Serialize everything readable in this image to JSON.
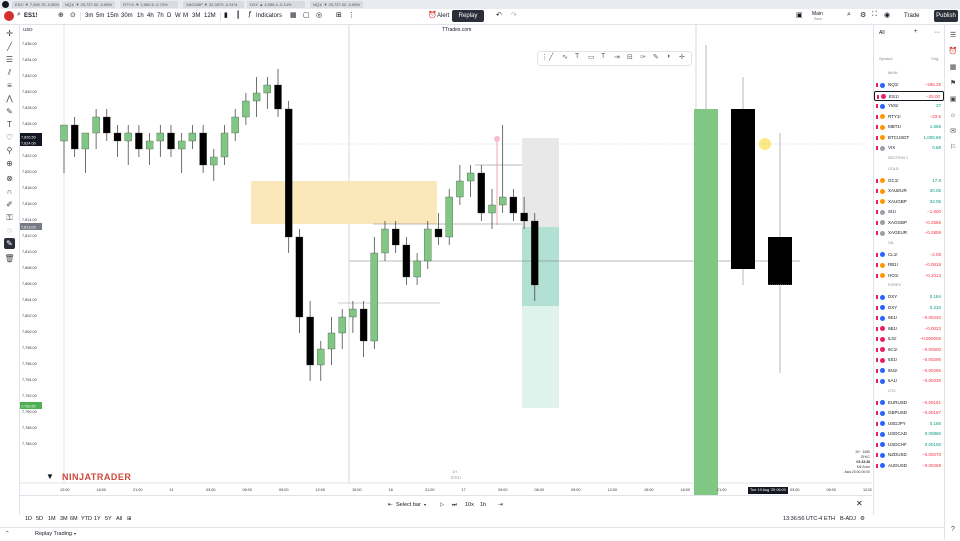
{
  "tabs": [
    {
      "label": "ES1! ▼ 7,590.75 -0.85%"
    },
    {
      "label": "NQ1! ▼ 25,727.00 -0.86%"
    },
    {
      "label": "RTY1! ▼ 2,560.6 -0.74%"
    },
    {
      "label": "XAGGBP ▼ 32.0579 -0.51%"
    },
    {
      "label": "DXY ▲ 4,556.4 -0.14%"
    },
    {
      "label": "NQ1! ▼ 25,727.00 -0.86%"
    }
  ],
  "toolbar": {
    "symbol": "ES1!",
    "intervals": [
      "3m",
      "5m",
      "15m",
      "30m",
      "1h",
      "4h",
      "7h",
      "D",
      "W",
      "M",
      "3M",
      "12M"
    ],
    "indicators_label": "Indicators",
    "alert_label": "Alert",
    "replay_label": "Replay",
    "layout_name": "Main",
    "layout_sub": "Save",
    "trade_label": "Trade",
    "publish_label": "Publish"
  },
  "chart": {
    "currency": "USD",
    "watermark": "TTrades.com",
    "brand": "NINJATRADER",
    "center_label_1": "1H",
    "center_label_2": "ES1!",
    "price_ticks": [
      "7,836.00",
      "7,834.00",
      "7,832.00",
      "7,830.00",
      "7,828.00",
      "7,826.00",
      "7,824.00",
      "7,822.00",
      "7,820.00",
      "7,818.00",
      "7,816.00",
      "7,814.00",
      "7,812.00",
      "7,810.00",
      "7,808.00",
      "7,806.00",
      "7,804.00",
      "7,802.00",
      "7,800.00",
      "7,798.00",
      "7,796.00",
      "7,794.00",
      "7,792.00",
      "7,790.00",
      "7,788.00",
      "7,786.00"
    ],
    "price_tags": [
      {
        "label": "7,826.50",
        "color": "#131722"
      },
      {
        "label": "7,824.00",
        "color": "#131722"
      },
      {
        "label": "7,813.00",
        "color": "#787b86"
      },
      {
        "label": "7,790.50",
        "color": "#4caf50"
      }
    ],
    "time_ticks": [
      "12:00",
      "18:00",
      "21:00",
      "11",
      "03:00",
      "06:00",
      "09:00",
      "12:00",
      "15:00",
      "18",
      "21:00",
      "17",
      "03:00",
      "06:00",
      "09:00",
      "12:00",
      "15:00",
      "18:00",
      "21:00",
      "18",
      "03:00",
      "06:00",
      "12:00"
    ],
    "cursor_time": "Tue 19 Aug '25 06:00",
    "info_box": [
      "1H · 1080",
      "OHLC",
      "03:43:38",
      "Kill Zone",
      "Asia 20:00-00:00"
    ]
  },
  "watchlist": {
    "header": "All",
    "col_symbol": "Symbol",
    "col_change": "Chg",
    "rows": [
      {
        "type": "section",
        "label": "MAIN"
      },
      {
        "type": "item",
        "symbol": "NQ1!",
        "change": "−265.25",
        "color": "#f23645",
        "dot": "#2962ff"
      },
      {
        "type": "item",
        "symbol": "ES1!",
        "change": "−25.00",
        "color": "#f23645",
        "dot": "#e91e63",
        "selected": true
      },
      {
        "type": "item",
        "symbol": "YM1!",
        "change": "37",
        "color": "#089981",
        "dot": "#2962ff"
      },
      {
        "type": "item",
        "symbol": "RTY1!",
        "change": "−23.6",
        "color": "#f23645",
        "dot": "#ff9800"
      },
      {
        "type": "item",
        "symbol": "MBT1!",
        "change": "1,665",
        "color": "#089981",
        "dot": "#ff9800"
      },
      {
        "type": "item",
        "symbol": "BTCUSDT",
        "change": "1,000.86",
        "color": "#089981",
        "dot": "#ff9800"
      },
      {
        "type": "item",
        "symbol": "VIX",
        "change": "0.68",
        "color": "#089981",
        "dot": "#9aa0a6"
      },
      {
        "type": "section",
        "label": "SECTION 1"
      },
      {
        "type": "section",
        "label": "GOLD"
      },
      {
        "type": "item",
        "symbol": "GC1!",
        "change": "17.8",
        "color": "#089981",
        "dot": "#ff9800"
      },
      {
        "type": "item",
        "symbol": "XAUEUR",
        "change": "20.05",
        "color": "#089981",
        "dot": "#ff9800"
      },
      {
        "type": "item",
        "symbol": "XAUGBP",
        "change": "32.05",
        "color": "#089981",
        "dot": "#ff9800"
      },
      {
        "type": "item",
        "symbol": "SI1!",
        "change": "−1.000",
        "color": "#f23645",
        "dot": "#9aa0a6"
      },
      {
        "type": "item",
        "symbol": "XAGGBP",
        "change": "−0.2565",
        "color": "#f23645",
        "dot": "#9aa0a6"
      },
      {
        "type": "item",
        "symbol": "XAGEUR",
        "change": "−0.2858",
        "color": "#f23645",
        "dot": "#9aa0a6"
      },
      {
        "type": "section",
        "label": "OIL"
      },
      {
        "type": "item",
        "symbol": "CL1!",
        "change": "−2.08",
        "color": "#f23645",
        "dot": "#2962ff"
      },
      {
        "type": "item",
        "symbol": "RB1!",
        "change": "−0.0818",
        "color": "#f23645",
        "dot": "#ff9800"
      },
      {
        "type": "item",
        "symbol": "HO1!",
        "change": "−0.2013",
        "color": "#f23645",
        "dot": "#ff9800"
      },
      {
        "type": "section",
        "label": "FOREX"
      },
      {
        "type": "item",
        "symbol": "DXY",
        "change": "0.184",
        "color": "#089981",
        "dot": "#2962ff"
      },
      {
        "type": "item",
        "symbol": "DXY",
        "change": "0.210",
        "color": "#089981",
        "dot": "#2962ff"
      },
      {
        "type": "item",
        "symbol": "6E1!",
        "change": "−0.00240",
        "color": "#f23645",
        "dot": "#2962ff"
      },
      {
        "type": "item",
        "symbol": "6B1!",
        "change": "−0.0023",
        "color": "#f23645",
        "dot": "#e91e63"
      },
      {
        "type": "item",
        "symbol": "6J1!",
        "change": "−0.000006",
        "color": "#f23645",
        "dot": "#e91e63"
      },
      {
        "type": "item",
        "symbol": "6C1!",
        "change": "−0.00500",
        "color": "#f23645",
        "dot": "#e91e63"
      },
      {
        "type": "item",
        "symbol": "6S1!",
        "change": "−0.00295",
        "color": "#f23645",
        "dot": "#e91e63"
      },
      {
        "type": "item",
        "symbol": "6N1!",
        "change": "−0.00295",
        "color": "#f23645",
        "dot": "#2962ff"
      },
      {
        "type": "item",
        "symbol": "6A1!",
        "change": "−0.00335",
        "color": "#f23645",
        "dot": "#2962ff"
      },
      {
        "type": "section",
        "label": "OTC"
      },
      {
        "type": "item",
        "symbol": "EURUSD",
        "change": "−0.00181",
        "color": "#f23645",
        "dot": "#2962ff"
      },
      {
        "type": "item",
        "symbol": "GBPUSD",
        "change": "−0.00187",
        "color": "#f23645",
        "dot": "#2962ff"
      },
      {
        "type": "item",
        "symbol": "USDJPY",
        "change": "0.166",
        "color": "#089981",
        "dot": "#2962ff"
      },
      {
        "type": "item",
        "symbol": "USDCAD",
        "change": "0.00860",
        "color": "#089981",
        "dot": "#2962ff"
      },
      {
        "type": "item",
        "symbol": "USDCHF",
        "change": "0.00150",
        "color": "#089981",
        "dot": "#2962ff"
      },
      {
        "type": "item",
        "symbol": "NZDUSD",
        "change": "−0.00270",
        "color": "#f23645",
        "dot": "#2962ff"
      },
      {
        "type": "item",
        "symbol": "AUDUSD",
        "change": "−0.00258",
        "color": "#f23645",
        "dot": "#2962ff"
      }
    ]
  },
  "replay_bar": {
    "select_bar": "Select bar",
    "speed": "10x",
    "interval": "1h"
  },
  "range_bar": {
    "ranges": [
      "1D",
      "5D",
      "1M",
      "3M",
      "6M",
      "YTD",
      "1Y",
      "5Y",
      "All"
    ],
    "time": "13:36:56 UTC-4",
    "session": "ETH",
    "adj": "B-ADJ"
  },
  "status": {
    "label": "Replay Trading"
  },
  "colors": {
    "bull": "#81c784",
    "bear": "#000000",
    "fvg": "#f9e6b3",
    "target": "#b2e0d2",
    "stop": "#e8e8e8"
  },
  "candles": [
    {
      "o": 7824,
      "h": 7826,
      "l": 7820,
      "c": 7826
    },
    {
      "o": 7826,
      "h": 7827,
      "l": 7822,
      "c": 7823
    },
    {
      "o": 7823,
      "h": 7825,
      "l": 7820,
      "c": 7825
    },
    {
      "o": 7825,
      "h": 7828,
      "l": 7823,
      "c": 7827
    },
    {
      "o": 7827,
      "h": 7828,
      "l": 7824,
      "c": 7825
    },
    {
      "o": 7825,
      "h": 7826,
      "l": 7822,
      "c": 7824
    },
    {
      "o": 7824,
      "h": 7826,
      "l": 7821,
      "c": 7825
    },
    {
      "o": 7825,
      "h": 7826,
      "l": 7822,
      "c": 7823
    },
    {
      "o": 7823,
      "h": 7825,
      "l": 7821,
      "c": 7824
    },
    {
      "o": 7824,
      "h": 7826,
      "l": 7822,
      "c": 7825
    },
    {
      "o": 7825,
      "h": 7826,
      "l": 7822,
      "c": 7823
    },
    {
      "o": 7823,
      "h": 7825,
      "l": 7820,
      "c": 7824
    },
    {
      "o": 7824,
      "h": 7826,
      "l": 7823,
      "c": 7825
    },
    {
      "o": 7825,
      "h": 7826,
      "l": 7820,
      "c": 7821
    },
    {
      "o": 7821,
      "h": 7823,
      "l": 7819,
      "c": 7822
    },
    {
      "o": 7822,
      "h": 7826,
      "l": 7821,
      "c": 7825
    },
    {
      "o": 7825,
      "h": 7828,
      "l": 7824,
      "c": 7827
    },
    {
      "o": 7827,
      "h": 7830,
      "l": 7826,
      "c": 7829
    },
    {
      "o": 7829,
      "h": 7832,
      "l": 7827,
      "c": 7830
    },
    {
      "o": 7830,
      "h": 7832,
      "l": 7828,
      "c": 7831
    },
    {
      "o": 7831,
      "h": 7833,
      "l": 7827,
      "c": 7828
    },
    {
      "o": 7828,
      "h": 7829,
      "l": 7810,
      "c": 7812
    },
    {
      "o": 7812,
      "h": 7813,
      "l": 7800,
      "c": 7802
    },
    {
      "o": 7802,
      "h": 7804,
      "l": 7794,
      "c": 7796
    },
    {
      "o": 7796,
      "h": 7799,
      "l": 7794,
      "c": 7798
    },
    {
      "o": 7798,
      "h": 7802,
      "l": 7796,
      "c": 7800
    },
    {
      "o": 7800,
      "h": 7803,
      "l": 7798,
      "c": 7802
    },
    {
      "o": 7802,
      "h": 7804,
      "l": 7800,
      "c": 7803
    },
    {
      "o": 7803,
      "h": 7804,
      "l": 7797,
      "c": 7799
    },
    {
      "o": 7799,
      "h": 7812,
      "l": 7798,
      "c": 7810
    },
    {
      "o": 7810,
      "h": 7814,
      "l": 7809,
      "c": 7813
    },
    {
      "o": 7813,
      "h": 7814,
      "l": 7810,
      "c": 7811
    },
    {
      "o": 7811,
      "h": 7812,
      "l": 7806,
      "c": 7807
    },
    {
      "o": 7807,
      "h": 7810,
      "l": 7806,
      "c": 7809
    },
    {
      "o": 7809,
      "h": 7814,
      "l": 7808,
      "c": 7813
    },
    {
      "o": 7813,
      "h": 7815,
      "l": 7811,
      "c": 7812
    },
    {
      "o": 7812,
      "h": 7818,
      "l": 7811,
      "c": 7817
    },
    {
      "o": 7817,
      "h": 7821,
      "l": 7816,
      "c": 7819
    },
    {
      "o": 7819,
      "h": 7821,
      "l": 7817,
      "c": 7820
    },
    {
      "o": 7820,
      "h": 7821,
      "l": 7814,
      "c": 7815
    },
    {
      "o": 7815,
      "h": 7818,
      "l": 7813,
      "c": 7816
    },
    {
      "o": 7816,
      "h": 7826,
      "l": 7815,
      "c": 7817
    },
    {
      "o": 7817,
      "h": 7818,
      "l": 7814,
      "c": 7815
    },
    {
      "o": 7815,
      "h": 7817,
      "l": 7813,
      "c": 7814
    },
    {
      "o": 7814,
      "h": 7815,
      "l": 7804,
      "c": 7806
    }
  ],
  "big_candles": [
    {
      "o": 7775,
      "h": 7836,
      "l": 7770,
      "c": 7828,
      "bull": true
    },
    {
      "o": 7828,
      "h": 7832,
      "l": 7806,
      "c": 7808,
      "bull": false
    },
    {
      "o": 7812,
      "h": 7825,
      "l": 7795,
      "c": 7806,
      "bull": false
    }
  ]
}
